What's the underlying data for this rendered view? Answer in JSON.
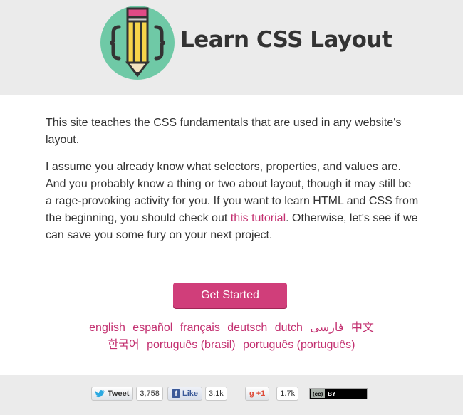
{
  "header": {
    "title": "Learn CSS Layout",
    "logo_icon": "pencil-braces-icon"
  },
  "intro": {
    "p1": "This site teaches the CSS fundamentals that are used in any website's layout.",
    "p2_before": "I assume you already know what selectors, properties, and values are. And you probably know a thing or two about layout, though it may still be a rage-provoking activity for you. If you want to learn HTML and CSS from the beginning, you should check out ",
    "p2_link": "this tutorial",
    "p2_after": ". Otherwise, let's see if we can save you some fury on your next project."
  },
  "cta": {
    "label": "Get Started"
  },
  "languages": [
    "english",
    "español",
    "français",
    "deutsch",
    "dutch",
    "فارسی",
    "中文",
    "한국어",
    "português (brasil)",
    "português (português)"
  ],
  "social": {
    "tweet_label": "Tweet",
    "tweet_count": "3,758",
    "like_label": "Like",
    "like_count": "3.1k",
    "gplus_label": "+1",
    "gplus_count": "1.7k",
    "cc_label": "(cc)",
    "cc_by": "BY"
  },
  "colors": {
    "accent": "#d03e7a",
    "link": "#c33070",
    "logo_circle": "#6fc9a6"
  }
}
